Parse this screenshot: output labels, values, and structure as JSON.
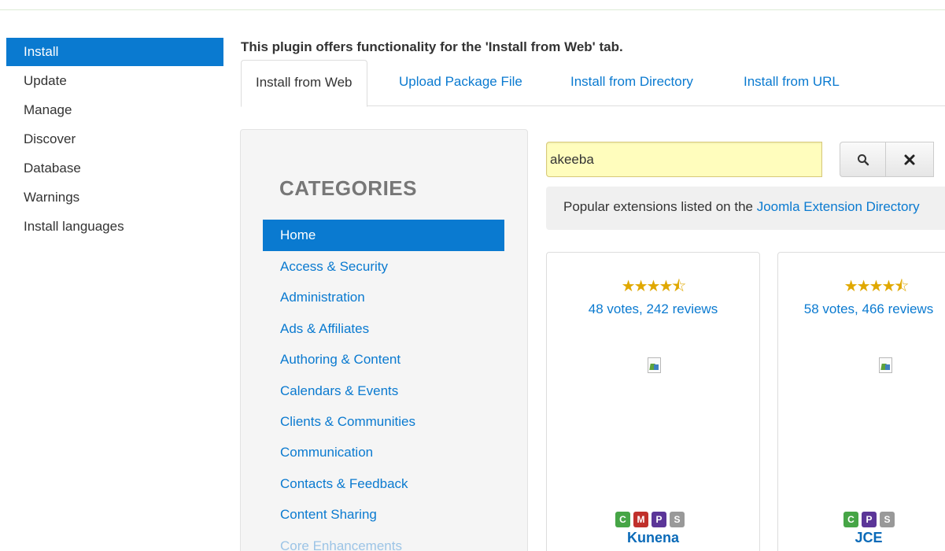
{
  "sidebar": {
    "items": [
      {
        "label": "Install",
        "active": true
      },
      {
        "label": "Update"
      },
      {
        "label": "Manage"
      },
      {
        "label": "Discover"
      },
      {
        "label": "Database"
      },
      {
        "label": "Warnings"
      },
      {
        "label": "Install languages"
      }
    ]
  },
  "plugin_description": "This plugin offers functionality for the 'Install from Web' tab.",
  "tabs": [
    {
      "label": "Install from Web",
      "active": true
    },
    {
      "label": "Upload Package File"
    },
    {
      "label": "Install from Directory"
    },
    {
      "label": "Install from URL"
    }
  ],
  "categories": {
    "title": "CATEGORIES",
    "items": [
      {
        "label": "Home",
        "active": true
      },
      {
        "label": "Access & Security"
      },
      {
        "label": "Administration"
      },
      {
        "label": "Ads & Affiliates"
      },
      {
        "label": "Authoring & Content"
      },
      {
        "label": "Calendars & Events"
      },
      {
        "label": "Clients & Communities"
      },
      {
        "label": "Communication"
      },
      {
        "label": "Contacts & Feedback"
      },
      {
        "label": "Content Sharing"
      },
      {
        "label": "Core Enhancements"
      }
    ]
  },
  "search": {
    "value": "akeeba",
    "search_icon": "search-icon",
    "clear_icon": "close-icon"
  },
  "info_bar": {
    "text": "Popular extensions listed on the ",
    "link": "Joomla Extension Directory"
  },
  "extensions": [
    {
      "stars": "★★★★⯪",
      "rating": 4.5,
      "votes": "48 votes, 242 reviews",
      "badges": [
        "C",
        "M",
        "P",
        "S"
      ],
      "name": "Kunena"
    },
    {
      "stars": "★★★★⯪",
      "rating": 4.5,
      "votes": "58 votes, 466 reviews",
      "badges": [
        "C",
        "P",
        "S"
      ],
      "name": "JCE"
    }
  ],
  "colors": {
    "accent": "#0a7ad0",
    "search_bg": "#fffdbd",
    "star": "#e0a800",
    "badge_c": "#46a546",
    "badge_m": "#c0302b",
    "badge_p": "#5b3598",
    "badge_s": "#999999"
  }
}
